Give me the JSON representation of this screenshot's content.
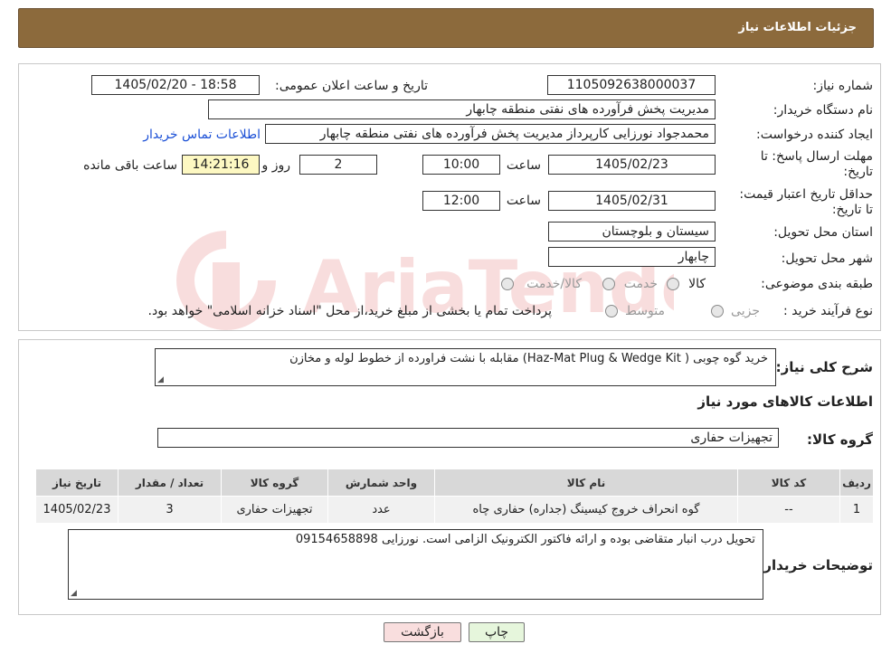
{
  "header": {
    "title": "جزئیات اطلاعات نیاز"
  },
  "form": {
    "need_number_label": "شماره نیاز:",
    "need_number": "1105092638000037",
    "announce_label": "تاریخ و ساعت اعلان عمومی:",
    "announce_value": "1405/02/20 - 18:58",
    "buyer_org_label": "نام دستگاه خریدار:",
    "buyer_org": "مدیریت پخش فرآورده های نفتی منطقه چابهار",
    "creator_label": "ایجاد کننده درخواست:",
    "creator": "محمدجواد نورزایی کارپرداز مدیریت پخش فرآورده های نفتی منطقه چابهار",
    "contact_link": "اطلاعات تماس خریدار",
    "reply_deadline_label": "مهلت ارسال پاسخ: تا تاریخ:",
    "reply_date": "1405/02/23",
    "time_label": "ساعت",
    "reply_time": "10:00",
    "days_value": "2",
    "days_label": "روز و",
    "remaining_time": "14:21:16",
    "remaining_label": "ساعت باقی مانده",
    "price_valid_label": "حداقل تاریخ اعتبار قیمت: تا تاریخ:",
    "price_date": "1405/02/31",
    "price_time": "12:00",
    "province_label": "استان محل تحویل:",
    "province": "سیستان و بلوچستان",
    "city_label": "شهر محل تحویل:",
    "city": "چابهار",
    "category_label": "طبقه بندی موضوعی:",
    "category_options": [
      "کالا",
      "خدمت",
      "کالا/خدمت"
    ],
    "process_label": "نوع فرآیند خرید :",
    "process_options": [
      "جزیی",
      "متوسط"
    ],
    "process_note": "پرداخت تمام یا بخشی از مبلغ خرید،از محل \"اسناد خزانه اسلامی\" خواهد بود."
  },
  "summary": {
    "label": "شرح کلی نیاز:",
    "text": "خرید گوه چوبی ( Haz-Mat Plug & Wedge Kit)  مقابله با نشت فراورده از خطوط  لوله و مخازن"
  },
  "goods": {
    "section_title": "اطلاعات کالاهای مورد نیاز",
    "group_label": "گروه کالا:",
    "group_value": "تجهیزات حفاری",
    "table": {
      "headers": [
        "ردیف",
        "کد کالا",
        "نام کالا",
        "واحد شمارش",
        "گروه کالا",
        "تعداد / مقدار",
        "تاریخ نیاز"
      ],
      "rows": [
        [
          "1",
          "--",
          "گوه انحراف خروج کیسینگ (جداره) حفاری چاه",
          "عدد",
          "تجهیزات حفاری",
          "3",
          "1405/02/23"
        ]
      ]
    }
  },
  "buyer_notes": {
    "label": "توضیحات خریدار:",
    "text": "تحویل درب انبار متقاضی بوده و ارائه فاکتور الکترونیک الزامی است. نورزایی 09154658898"
  },
  "buttons": {
    "print": "چاپ",
    "back": "بازگشت"
  },
  "colors": {
    "header_bg": "#8c6a3c",
    "back_btn": "#f9dede",
    "print_btn": "#e6f6dc",
    "link": "#1a4fd6"
  }
}
